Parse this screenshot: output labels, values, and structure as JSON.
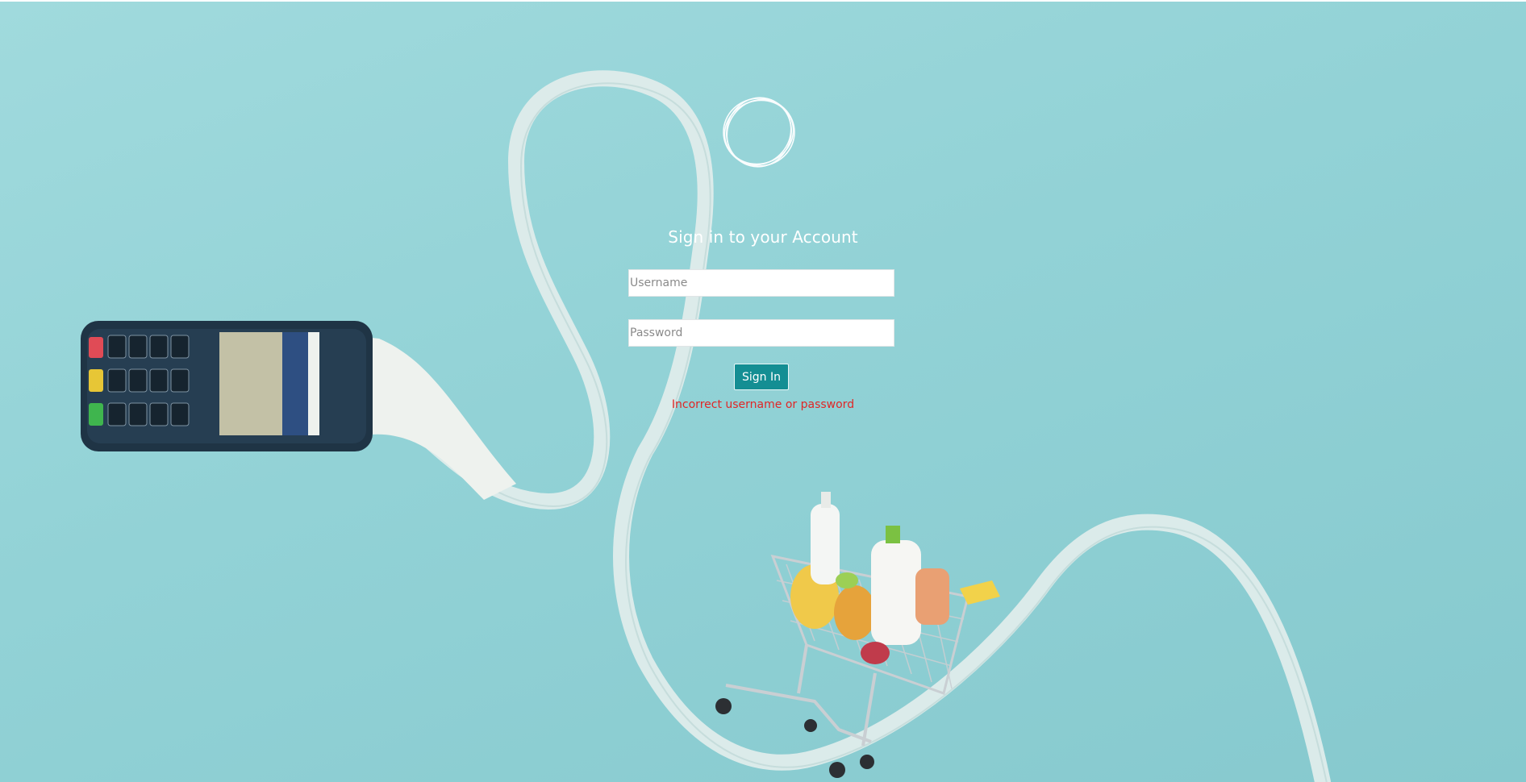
{
  "page": {
    "title": "Sign in to your Account"
  },
  "form": {
    "username_placeholder": "Username",
    "username_value": "",
    "password_placeholder": "Password",
    "password_value": "",
    "submit_label": "Sign In",
    "error_message": "Incorrect username or password"
  },
  "colors": {
    "background": "#95d4d8",
    "button": "#148e93",
    "error": "#e02626",
    "title": "#ffffff"
  },
  "icons": {
    "logo": "circle-rings-logo"
  },
  "background_illustration": {
    "elements": [
      "payment-terminal",
      "receipt-paper",
      "shopping-cart"
    ]
  }
}
